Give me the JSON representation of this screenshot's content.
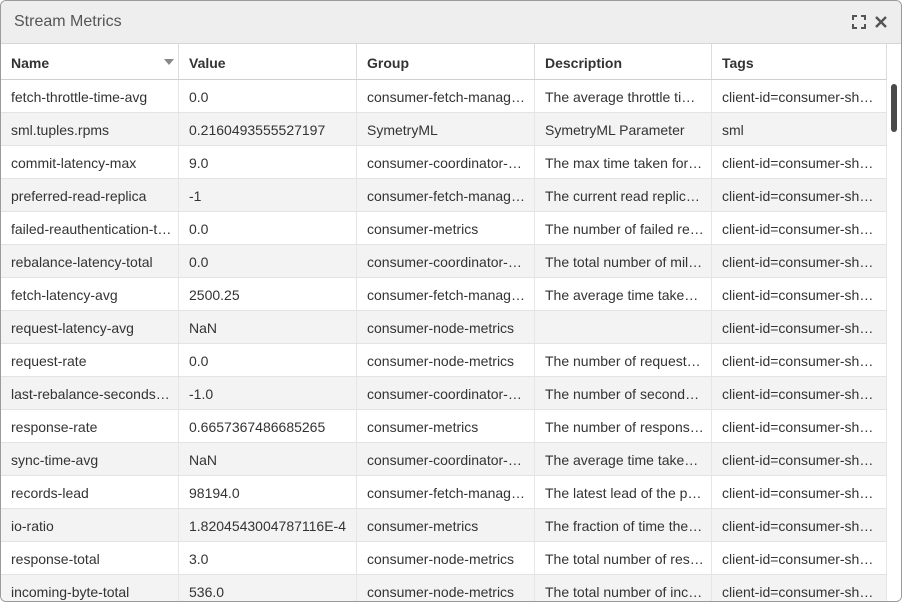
{
  "window": {
    "title": "Stream Metrics",
    "maximize_icon": "maximize-icon",
    "close_icon": "close-icon"
  },
  "table": {
    "columns": [
      "Name",
      "Value",
      "Group",
      "Description",
      "Tags"
    ],
    "sorted_column": "Name",
    "rows": [
      [
        "fetch-throttle-time-avg",
        "0.0",
        "consumer-fetch-manager-metrics",
        "The average throttle time in ms",
        "client-id=consumer-shuttle"
      ],
      [
        "sml.tuples.rpms",
        "0.2160493555527197",
        "SymetryML",
        "SymetryML Parameter",
        "sml"
      ],
      [
        "commit-latency-max",
        "9.0",
        "consumer-coordinator-metrics",
        "The max time taken for a commit request",
        "client-id=consumer-shuttle"
      ],
      [
        "preferred-read-replica",
        "-1",
        "consumer-fetch-manager-metrics",
        "The current read replica for the partition",
        "client-id=consumer-shuttle"
      ],
      [
        "failed-reauthentication-total",
        "0.0",
        "consumer-metrics",
        "The number of failed re-authentication",
        "client-id=consumer-shuttle"
      ],
      [
        "rebalance-latency-total",
        "0.0",
        "consumer-coordinator-metrics",
        "The total number of milliseconds",
        "client-id=consumer-shuttle"
      ],
      [
        "fetch-latency-avg",
        "2500.25",
        "consumer-fetch-manager-metrics",
        "The average time taken for a fetch request",
        "client-id=consumer-shuttle"
      ],
      [
        "request-latency-avg",
        "NaN",
        "consumer-node-metrics",
        "",
        "client-id=consumer-shuttle"
      ],
      [
        "request-rate",
        "0.0",
        "consumer-node-metrics",
        "The number of requests sent per second",
        "client-id=consumer-shuttle"
      ],
      [
        "last-rebalance-seconds-ago",
        "-1.0",
        "consumer-coordinator-metrics",
        "The number of seconds since the last rebalance",
        "client-id=consumer-shuttle"
      ],
      [
        "response-rate",
        "0.6657367486685265",
        "consumer-metrics",
        "The number of responses received per second",
        "client-id=consumer-shuttle"
      ],
      [
        "sync-time-avg",
        "NaN",
        "consumer-coordinator-metrics",
        "The average time taken for a group sync",
        "client-id=consumer-shuttle"
      ],
      [
        "records-lead",
        "98194.0",
        "consumer-fetch-manager-metrics",
        "The latest lead of the partition",
        "client-id=consumer-shuttle"
      ],
      [
        "io-ratio",
        "1.8204543004787116E-4",
        "consumer-metrics",
        "The fraction of time the I/O thread spent",
        "client-id=consumer-shuttle"
      ],
      [
        "response-total",
        "3.0",
        "consumer-node-metrics",
        "The total number of responses received",
        "client-id=consumer-shuttle"
      ],
      [
        "incoming-byte-total",
        "536.0",
        "consumer-node-metrics",
        "The total number of incoming bytes",
        "client-id=consumer-shuttle"
      ]
    ]
  }
}
